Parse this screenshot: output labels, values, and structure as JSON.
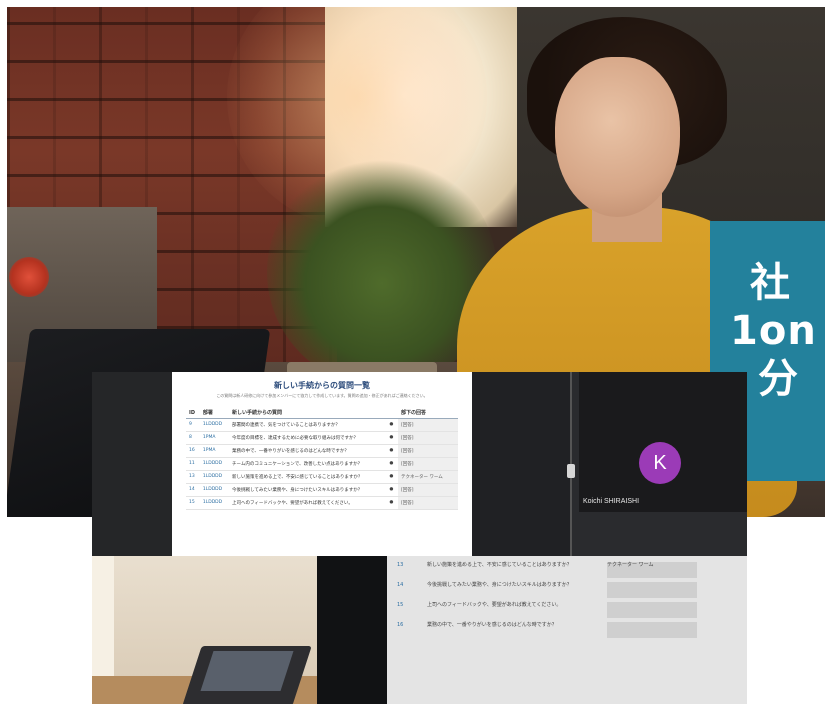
{
  "title_panel": {
    "lines": [
      "社",
      "1on",
      "分"
    ],
    "background": "#23819c"
  },
  "video_call": {
    "document": {
      "title": "新しい手続からの質問一覧",
      "subtitle": "この質問は新人研修に向けて参加メンバーにて協力して作成しています。質問の追加・修正があればご連絡ください。",
      "columns": [
        "ID",
        "部署",
        "新しい手続からの質問",
        "",
        "部下の回答"
      ],
      "rows": [
        {
          "id": "9",
          "dept": "1LDDDD",
          "question": "部署間の連携で、気をつけていることはありますか？",
          "mark": "●",
          "answer": "[回答]"
        },
        {
          "id": "8",
          "dept": "1PMA",
          "question": "今年度の目標を、達成するために必要な取り組みは何ですか？",
          "mark": "●",
          "answer": "[回答]"
        },
        {
          "id": "16",
          "dept": "1PMA",
          "question": "業務の中で、一番やりがいを感じるのはどんな時ですか？",
          "mark": "●",
          "answer": "[回答]"
        },
        {
          "id": "11",
          "dept": "1LDDDD",
          "question": "チーム内のコミュニケーションで、改善したい点はありますか？",
          "mark": "●",
          "answer": "[回答]"
        },
        {
          "id": "13",
          "dept": "1LDDDD",
          "question": "新しい施策を進める上で、不安に感じていることはありますか？",
          "mark": "●",
          "answer": "テクネーター ワーム"
        },
        {
          "id": "14",
          "dept": "1LDDDD",
          "question": "今後挑戦してみたい業務や、身につけたいスキルはありますか？",
          "mark": "●",
          "answer": "[回答]"
        },
        {
          "id": "15",
          "dept": "1LDDDD",
          "question": "上司へのフィードバックや、要望があれば教えてください。",
          "mark": "●",
          "answer": "[回答]"
        }
      ]
    },
    "participant": {
      "initial": "K",
      "name": "Koichi SHIRAISHI",
      "avatar_color": "#9b3bb7"
    }
  },
  "monitor": {
    "rows": [
      {
        "id": "13",
        "text": "新しい施策を進める上で、不安に感じていることはありますか？",
        "answer": "テクネーター ワーム"
      },
      {
        "id": "14",
        "text": "今後挑戦してみたい業務や、身につけたいスキルはありますか？",
        "answer": ""
      },
      {
        "id": "15",
        "text": "上司へのフィードバックや、要望があれば教えてください。",
        "answer": ""
      },
      {
        "id": "16",
        "text": "業務の中で、一番やりがいを感じるのはどんな時ですか？",
        "answer": ""
      }
    ]
  }
}
